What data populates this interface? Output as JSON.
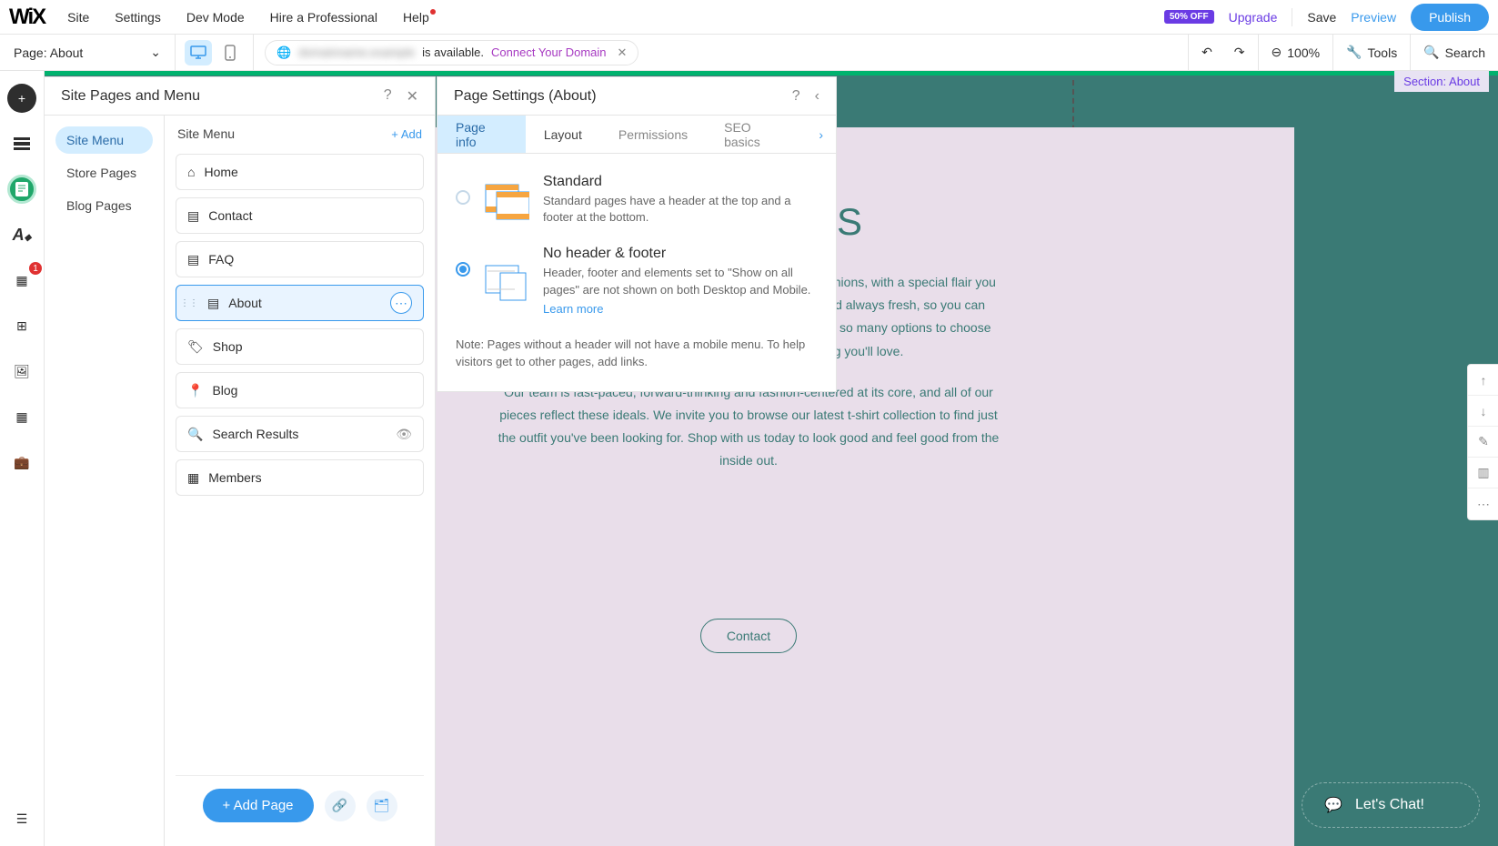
{
  "topbar": {
    "logo": "WiX",
    "menu": [
      "Site",
      "Settings",
      "Dev Mode",
      "Hire a Professional",
      "Help"
    ],
    "discount": "50% OFF",
    "upgrade": "Upgrade",
    "save": "Save",
    "preview": "Preview",
    "publish": "Publish"
  },
  "secondbar": {
    "page_label": "Page: About",
    "domain_blurred": "domainname.example",
    "domain_available": "is available.",
    "connect": "Connect Your Domain",
    "zoom": "100%",
    "tools": "Tools",
    "search": "Search"
  },
  "rail": {
    "badge_count": "1"
  },
  "panel1": {
    "title": "Site Pages and Menu",
    "nav": [
      "Site Menu",
      "Store Pages",
      "Blog Pages"
    ],
    "list_title": "Site Menu",
    "add": "Add",
    "pages": [
      "Home",
      "Contact",
      "FAQ",
      "About",
      "Shop",
      "Blog",
      "Search Results",
      "Members"
    ],
    "selected_index": 3,
    "add_page": "Add Page"
  },
  "panel2": {
    "title_prefix": "Page Settings (",
    "title_page": "About",
    "title_suffix": ")",
    "tabs": [
      "Page info",
      "Layout",
      "Permissions",
      "SEO basics"
    ],
    "standard": {
      "title": "Standard",
      "desc": "Standard pages have a header at the top and a footer at the bottom."
    },
    "nohf": {
      "title": "No header & footer",
      "desc": "Header, footer and elements set to \"Show on all pages\" are not shown on both Desktop and Mobile.",
      "link": "Learn more"
    },
    "note": "Note: Pages without a header will not have a mobile menu. To help visitors get to other pages, add links."
  },
  "canvas": {
    "section_label": "Section: About",
    "about_title": "ABOUT US",
    "para1": "In Style is your go-to source for styles influenced by the fashions, with a special flair you won't find anywhere else. Our selection is wide, varied and always fresh, so you can discover something new every time you shop with us. With so many options to choose from, you're sure to come across something you'll love.",
    "para2": "Our team is fast-paced, forward-thinking and fashion-centered at its core, and all of our pieces reflect these ideals. We invite you to browse our latest t-shirt collection to find just the outfit you've been looking for. Shop with us today to look good and feel good from the inside out.",
    "contact_btn": "Contact"
  },
  "chat": {
    "label": "Let's Chat!"
  }
}
